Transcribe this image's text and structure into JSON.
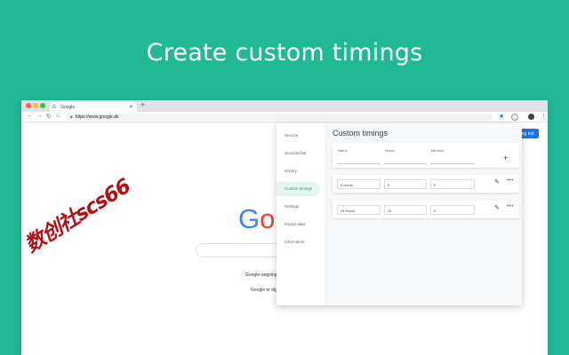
{
  "headline": "Create custom timings",
  "browser": {
    "tab_title": "Google",
    "tab_favicon": "G",
    "url": "https://www.google.dk",
    "sign_in_label": "Log ind"
  },
  "google_page": {
    "logo_letters": [
      "G",
      "o"
    ],
    "search_button_label": "Google-søgning",
    "offered_in_text": "Google er tilg"
  },
  "watermark": "数创社scs66",
  "popup": {
    "sidebar": [
      {
        "label": "Snooze",
        "active": false
      },
      {
        "label": "Snoozed list",
        "active": false
      },
      {
        "label": "History",
        "active": false
      },
      {
        "label": "Custom timings",
        "active": true
      },
      {
        "label": "Settings",
        "active": false
      },
      {
        "label": "Export data",
        "active": false
      },
      {
        "label": "Information",
        "active": false
      }
    ],
    "title": "Custom timings",
    "columns": {
      "name": "Name",
      "hours": "Hours",
      "minutes": "Minutes"
    },
    "timings": [
      {
        "name": "6 Hours",
        "hours": "6",
        "minutes": "0"
      },
      {
        "name": "24 Hours",
        "hours": "24",
        "minutes": "0"
      }
    ]
  },
  "colors": {
    "background": "#1fba94",
    "active_item_bg": "#e3f6f0",
    "active_item_text": "#1b9e7c",
    "signin_blue": "#1a73e8"
  }
}
